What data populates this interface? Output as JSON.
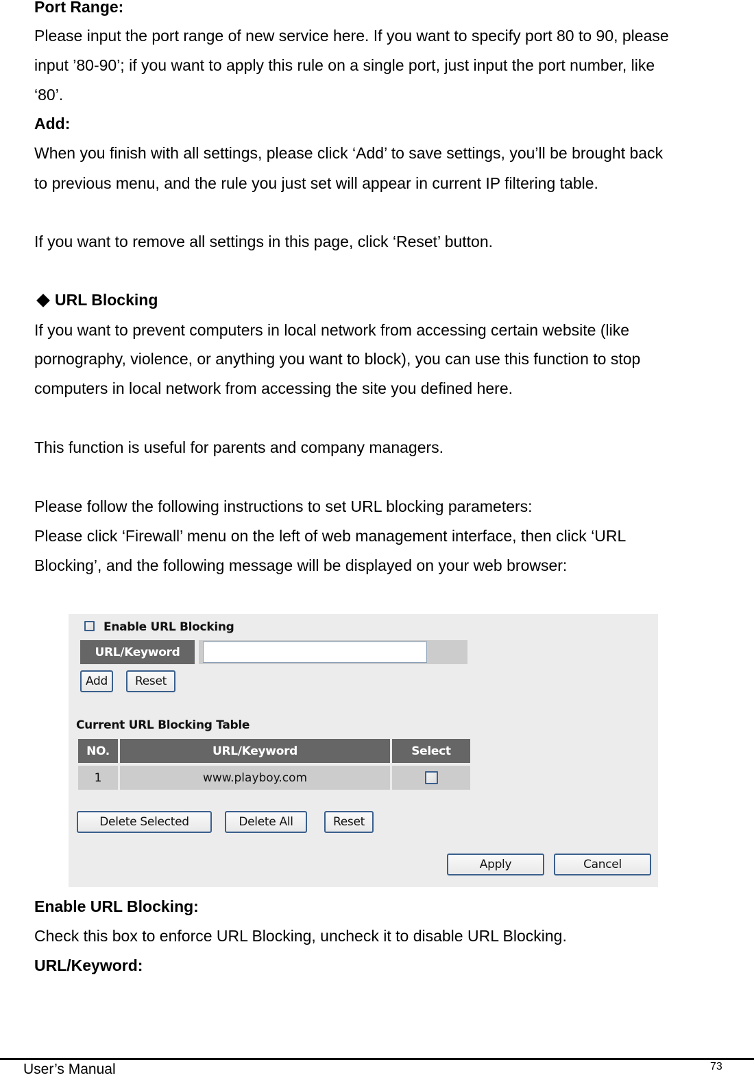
{
  "sections": {
    "port_range": {
      "title": "Port Range:",
      "lines": [
        "Please input the port range of new service here. If you want to specify port 80 to 90, please",
        "input ’80-90’; if you want to apply this rule on a single port, just input the port number, like",
        "‘80’."
      ]
    },
    "add": {
      "title": "Add:",
      "lines": [
        "When you finish with all settings, please click ‘Add’ to save settings, you’ll be brought back",
        "to previous menu, and the rule you just set will appear in current IP filtering table."
      ]
    },
    "reset_note": "If you want to remove all settings in this page, click ‘Reset’ button.",
    "url_blocking": {
      "title": "URL Blocking",
      "intro_lines": [
        "If you want to prevent computers in local network from accessing certain website (like",
        "pornography, violence, or anything you want to block), you can use this function to stop",
        "computers in local network from accessing the site you defined here."
      ],
      "useful_note": "This function is useful for parents and company managers.",
      "instructions_lines": [
        "Please follow the following instructions to set URL blocking parameters:",
        "Please click ‘Firewall’ menu on the left of web management interface, then click ‘URL",
        "Blocking’, and the following message will be displayed on your web browser:"
      ]
    },
    "enable_desc": {
      "title": "Enable URL Blocking:",
      "text": "Check this box to enforce URL Blocking, uncheck it to disable URL Blocking."
    },
    "url_keyword_desc": {
      "title": "URL/Keyword:"
    }
  },
  "screenshot": {
    "enable_label": "Enable URL Blocking",
    "enable_checked": false,
    "url_keyword_label": "URL/Keyword",
    "url_keyword_value": "",
    "add_button": "Add",
    "reset_button": "Reset",
    "table_title": "Current URL Blocking Table",
    "table": {
      "columns": [
        "NO.",
        "URL/Keyword",
        "Select"
      ],
      "rows": [
        {
          "no": "1",
          "url": "www.playboy.com",
          "selected": false
        }
      ]
    },
    "delete_selected_button": "Delete Selected",
    "delete_all_button": "Delete All",
    "table_reset_button": "Reset",
    "apply_button": "Apply",
    "cancel_button": "Cancel"
  },
  "footer": {
    "left": "User’s Manual",
    "page_number": "73"
  }
}
